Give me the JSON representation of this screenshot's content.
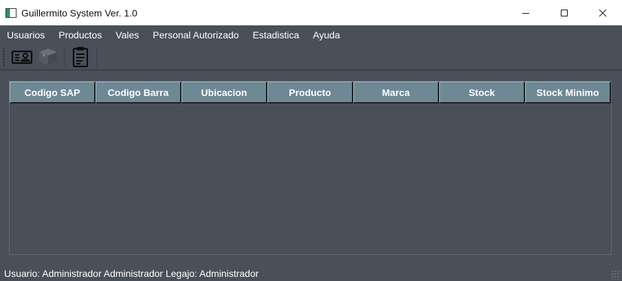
{
  "window": {
    "title": "Guillermito System Ver. 1.0",
    "controls": [
      "minimize",
      "maximize",
      "close"
    ]
  },
  "menu": {
    "items": [
      {
        "label": "Usuarios"
      },
      {
        "label": "Productos"
      },
      {
        "label": "Vales"
      },
      {
        "label": "Personal Autorizado"
      },
      {
        "label": "Estadistica"
      },
      {
        "label": "Ayuda"
      }
    ]
  },
  "toolbar": {
    "buttons": [
      {
        "icon": "id-card-icon",
        "enabled": true
      },
      {
        "icon": "package-box-icon",
        "enabled": false
      },
      {
        "icon": "clipboard-list-icon",
        "enabled": true
      }
    ]
  },
  "grid": {
    "columns": [
      {
        "label": "Codigo SAP"
      },
      {
        "label": "Codigo Barra"
      },
      {
        "label": "Ubicacion"
      },
      {
        "label": "Producto"
      },
      {
        "label": "Marca"
      },
      {
        "label": "Stock"
      },
      {
        "label": "Stock Minimo"
      }
    ],
    "rows": []
  },
  "status": {
    "text": "Usuario: Administrador Administrador Legajo: Administrador"
  },
  "colors": {
    "background": "#4a505a",
    "header": "#6e8896",
    "titlebar": "#ffffff"
  }
}
